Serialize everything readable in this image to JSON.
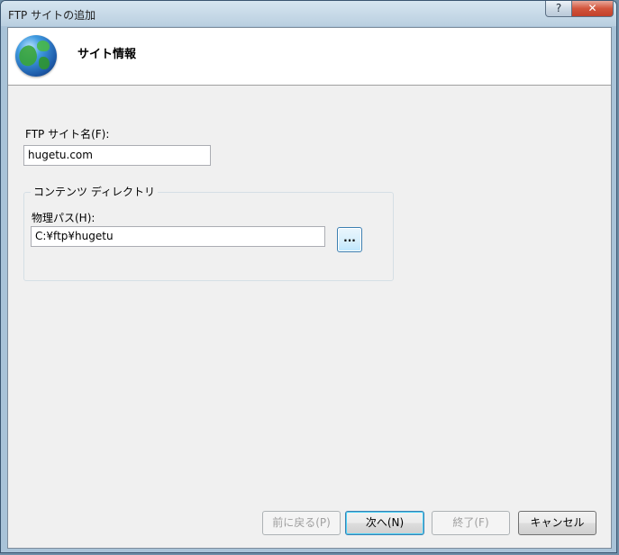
{
  "window": {
    "title": "FTP サイトの追加",
    "help_label": "?",
    "close_label": "✕"
  },
  "header": {
    "title": "サイト情報"
  },
  "site_name": {
    "label": "FTP サイト名(F):",
    "value": "hugetu.com"
  },
  "content_directory": {
    "group_label": "コンテンツ ディレクトリ",
    "path_label": "物理パス(H):",
    "path_value": "C:¥ftp¥hugetu",
    "browse_label": "..."
  },
  "footer": {
    "back_label": "前に戻る(P)",
    "next_label": "次へ(N)",
    "finish_label": "終了(F)",
    "cancel_label": "キャンセル"
  },
  "colors": {
    "accent": "#3c7fb1",
    "dialog_bg": "#f0f0f0"
  },
  "icons": {
    "header_icon": "globe-icon"
  }
}
